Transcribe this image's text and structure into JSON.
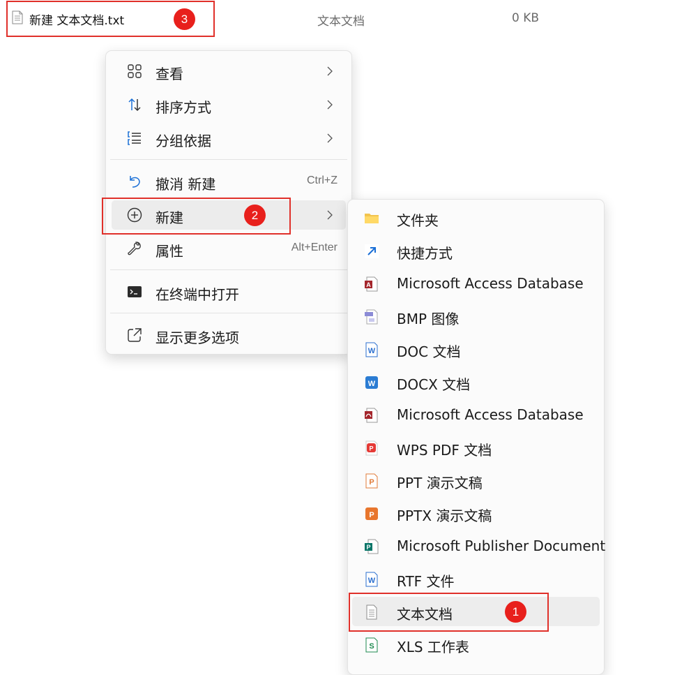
{
  "file": {
    "name": "新建 文本文档.txt",
    "type": "文本文档",
    "size": "0 KB"
  },
  "badges": [
    "1",
    "2",
    "3"
  ],
  "context_menu": {
    "items": [
      {
        "label": "查看",
        "icon": "grid-view-icon"
      },
      {
        "label": "排序方式",
        "icon": "sort-icon"
      },
      {
        "label": "分组依据",
        "icon": "group-by-icon"
      },
      {
        "label": "撤消 新建",
        "shortcut": "Ctrl+Z",
        "icon": "undo-icon"
      },
      {
        "label": "新建",
        "icon": "add-circle-icon"
      },
      {
        "label": "属性",
        "shortcut": "Alt+Enter",
        "icon": "wrench-icon"
      },
      {
        "label": "在终端中打开",
        "icon": "terminal-icon"
      },
      {
        "label": "显示更多选项",
        "icon": "open-external-icon"
      }
    ]
  },
  "new_submenu": {
    "items": [
      {
        "label": "文件夹",
        "icon": "folder-icon"
      },
      {
        "label": "快捷方式",
        "icon": "shortcut-icon"
      },
      {
        "label": "Microsoft Access Database",
        "icon": "access-icon"
      },
      {
        "label": "BMP 图像",
        "icon": "bmp-icon"
      },
      {
        "label": "DOC 文档",
        "icon": "doc-icon"
      },
      {
        "label": "DOCX 文档",
        "icon": "docx-icon"
      },
      {
        "label": "Microsoft Access Database",
        "icon": "access-pdf-icon"
      },
      {
        "label": "WPS PDF 文档",
        "icon": "wps-pdf-icon"
      },
      {
        "label": "PPT 演示文稿",
        "icon": "ppt-icon"
      },
      {
        "label": "PPTX 演示文稿",
        "icon": "pptx-icon"
      },
      {
        "label": "Microsoft Publisher Document",
        "icon": "publisher-icon"
      },
      {
        "label": "RTF 文件",
        "icon": "rtf-icon"
      },
      {
        "label": "文本文档",
        "icon": "text-document-icon"
      },
      {
        "label": "XLS 工作表",
        "icon": "xls-icon"
      }
    ]
  },
  "colors": {
    "annotation": "#e0302a",
    "badge": "#e8201c",
    "accent": "#1a6fd6"
  }
}
